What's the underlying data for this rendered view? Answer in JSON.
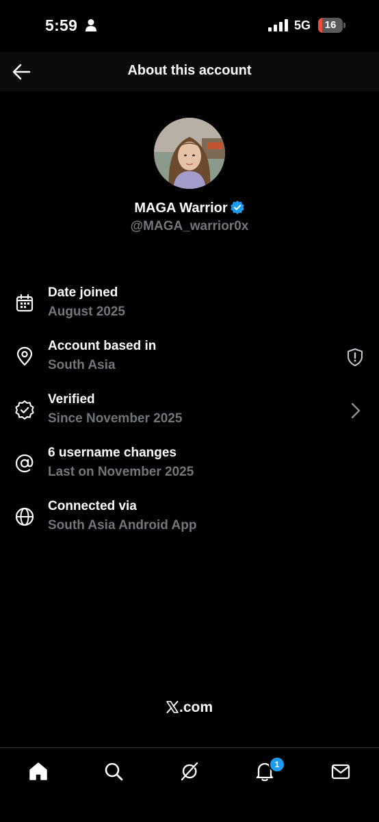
{
  "status_bar": {
    "time": "5:59",
    "network": "5G",
    "battery_level": "16",
    "battery_fraction": 0.16,
    "battery_color": "#eb4d3d"
  },
  "header": {
    "title": "About this account",
    "back_icon": "arrow-left-icon"
  },
  "profile": {
    "name": "MAGA Warrior",
    "handle": "@MAGA_warrior0x",
    "verified_color": "#1d9bf0"
  },
  "info_rows": [
    {
      "icon": "calendar-icon",
      "title": "Date joined",
      "value": "August 2025"
    },
    {
      "icon": "location-pin-icon",
      "title": "Account based in",
      "value": "South Asia",
      "trailing_icon": "shield-alert-icon"
    },
    {
      "icon": "verified-badge-outline-icon",
      "title": "Verified",
      "value": "Since November 2025",
      "trailing_icon": "chevron-right-icon"
    },
    {
      "icon": "at-sign-icon",
      "title": "6 username changes",
      "value": "Last on November 2025"
    },
    {
      "icon": "globe-icon",
      "title": "Connected via",
      "value": "South Asia Android App"
    }
  ],
  "footer": {
    "logo_text": ".com"
  },
  "tab_bar": {
    "tabs": [
      {
        "name": "home",
        "icon": "home-icon"
      },
      {
        "name": "search",
        "icon": "search-icon"
      },
      {
        "name": "grok",
        "icon": "grok-icon"
      },
      {
        "name": "notifications",
        "icon": "bell-icon",
        "badge": "1"
      },
      {
        "name": "messages",
        "icon": "envelope-icon"
      }
    ]
  },
  "colors": {
    "background": "#000000",
    "primary_text": "#ffffff",
    "secondary_text": "#71767b",
    "accent": "#1d9bf0"
  }
}
